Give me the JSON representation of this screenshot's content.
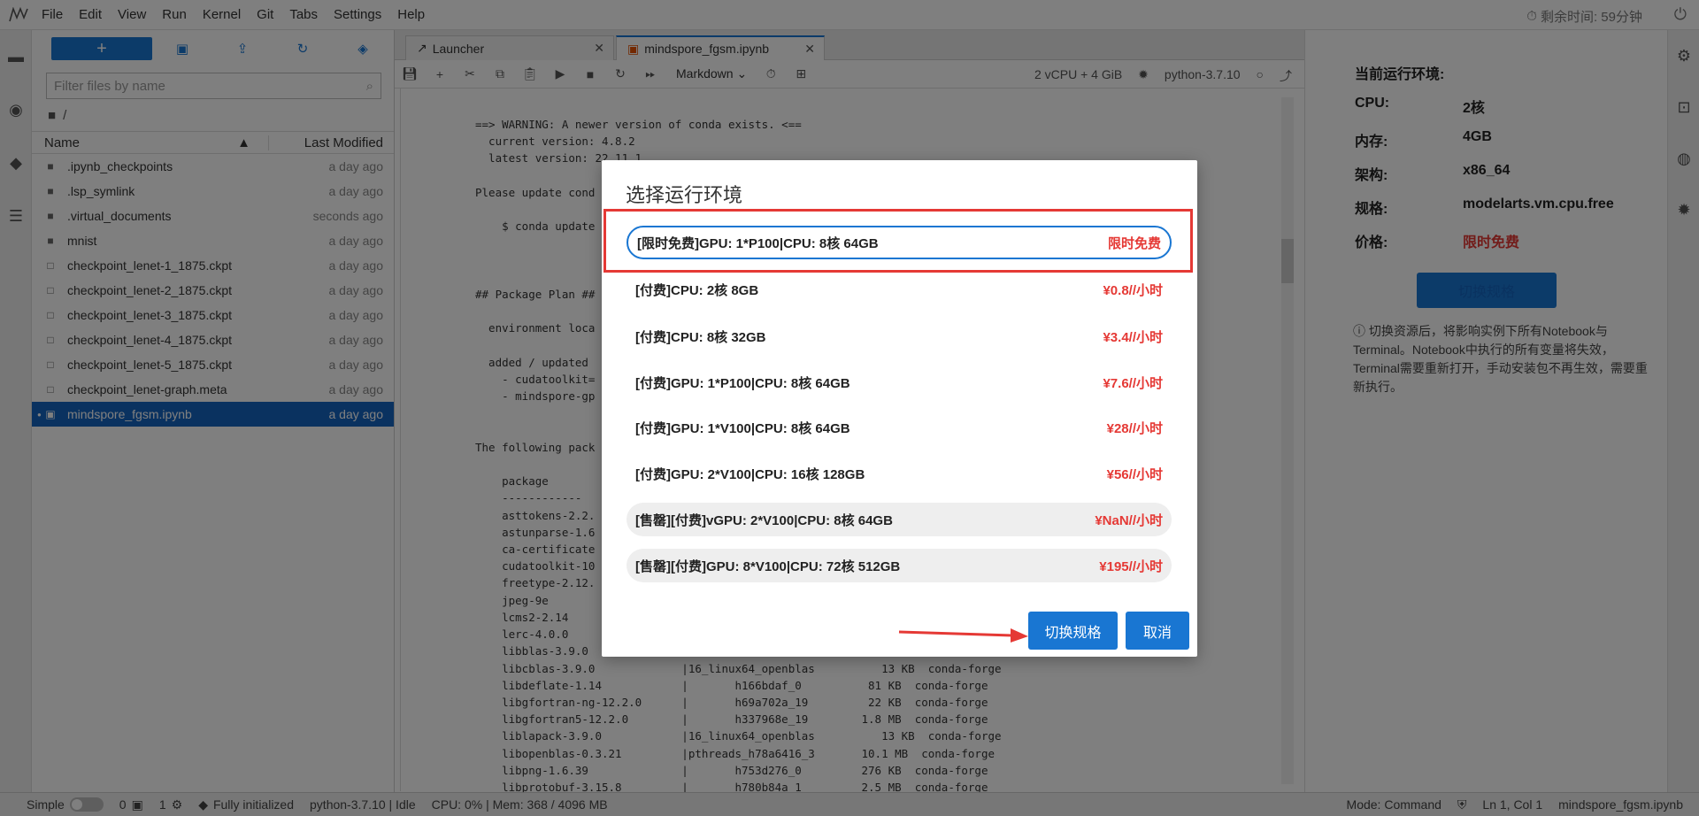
{
  "menubar": {
    "items": [
      "File",
      "Edit",
      "View",
      "Run",
      "Kernel",
      "Git",
      "Tabs",
      "Settings",
      "Help"
    ],
    "timer": "剩余时间: 59分钟"
  },
  "filebrowser": {
    "search_placeholder": "Filter files by name",
    "path": "/",
    "col_name": "Name",
    "col_modified": "Last Modified",
    "files": [
      {
        "name": ".ipynb_checkpoints",
        "modified": "a day ago",
        "type": "folder"
      },
      {
        "name": ".lsp_symlink",
        "modified": "a day ago",
        "type": "folder"
      },
      {
        "name": ".virtual_documents",
        "modified": "seconds ago",
        "type": "folder"
      },
      {
        "name": "mnist",
        "modified": "a day ago",
        "type": "folder"
      },
      {
        "name": "checkpoint_lenet-1_1875.ckpt",
        "modified": "a day ago",
        "type": "file"
      },
      {
        "name": "checkpoint_lenet-2_1875.ckpt",
        "modified": "a day ago",
        "type": "file"
      },
      {
        "name": "checkpoint_lenet-3_1875.ckpt",
        "modified": "a day ago",
        "type": "file"
      },
      {
        "name": "checkpoint_lenet-4_1875.ckpt",
        "modified": "a day ago",
        "type": "file"
      },
      {
        "name": "checkpoint_lenet-5_1875.ckpt",
        "modified": "a day ago",
        "type": "file"
      },
      {
        "name": "checkpoint_lenet-graph.meta",
        "modified": "a day ago",
        "type": "file"
      },
      {
        "name": "mindspore_fgsm.ipynb",
        "modified": "a day ago",
        "type": "notebook"
      }
    ]
  },
  "tabs": {
    "launcher": "Launcher",
    "notebook": "mindspore_fgsm.ipynb"
  },
  "toolbar": {
    "cell_type": "Markdown",
    "resources": "2 vCPU + 4 GiB",
    "kernel": "python-3.7.10"
  },
  "output_lines": [
    "==> WARNING: A newer version of conda exists. <==",
    "  current version: 4.8.2",
    "  latest version: 22.11.1",
    "",
    "Please update cond",
    "",
    "    $ conda update",
    "",
    "",
    "",
    "## Package Plan ##",
    "",
    "  environment loca",
    "",
    "  added / updated",
    "    - cudatoolkit=",
    "    - mindspore-gp",
    "",
    "",
    "The following pack",
    "",
    "    package",
    "    ------------",
    "    asttokens-2.2.",
    "    astunparse-1.6",
    "    ca-certificate",
    "    cudatoolkit-10",
    "    freetype-2.12.",
    "    jpeg-9e",
    "    lcms2-2.14",
    "    lerc-4.0.0",
    "    libblas-3.9.0",
    "    libcblas-3.9.0             |16_linux64_openblas          13 KB  conda-forge",
    "    libdeflate-1.14            |       h166bdaf_0          81 KB  conda-forge",
    "    libgfortran-ng-12.2.0      |       h69a702a_19         22 KB  conda-forge",
    "    libgfortran5-12.2.0        |       h337968e_19        1.8 MB  conda-forge",
    "    liblapack-3.9.0            |16_linux64_openblas          13 KB  conda-forge",
    "    libopenblas-0.3.21         |pthreads_h78a6416_3       10.1 MB  conda-forge",
    "    libpng-1.6.39              |       h753d276_0         276 KB  conda-forge",
    "    libprotobuf-3.15.8         |       h780b84a_1         2.5 MB  conda-forge"
  ],
  "rightpanel": {
    "title": "当前运行环境:",
    "rows": [
      {
        "k": "CPU:",
        "v": "2核"
      },
      {
        "k": "内存:",
        "v": "4GB"
      },
      {
        "k": "架构:",
        "v": "x86_64"
      },
      {
        "k": "规格:",
        "v": "modelarts.vm.cpu.free"
      },
      {
        "k": "价格:",
        "v": "限时免费"
      }
    ],
    "switch_label": "切换规格",
    "note": "ⓘ 切换资源后，将影响实例下所有Notebook与Terminal。Notebook中执行的所有变量将失效，Terminal需要重新打开，手动安装包不再生效，需要重新执行。"
  },
  "statusbar": {
    "simple": "Simple",
    "count1": "0",
    "count2": "1",
    "initialized": "Fully initialized",
    "kernel_status": "python-3.7.10 | Idle",
    "mem": "CPU: 0% | Mem: 368 / 4096 MB",
    "mode": "Mode: Command",
    "cursor": "Ln 1, Col 1",
    "file": "mindspore_fgsm.ipynb"
  },
  "modal": {
    "title": "选择运行环境",
    "options": [
      {
        "label": "[限时免费]GPU: 1*P100|CPU: 8核 64GB",
        "price": "限时免费",
        "state": "selected"
      },
      {
        "label": "[付费]CPU: 2核 8GB",
        "price": "¥0.8//小时",
        "state": "normal"
      },
      {
        "label": "[付费]CPU: 8核 32GB",
        "price": "¥3.4//小时",
        "state": "normal"
      },
      {
        "label": "[付费]GPU: 1*P100|CPU: 8核 64GB",
        "price": "¥7.6//小时",
        "state": "normal"
      },
      {
        "label": "[付费]GPU: 1*V100|CPU: 8核 64GB",
        "price": "¥28//小时",
        "state": "normal"
      },
      {
        "label": "[付费]GPU: 2*V100|CPU: 16核 128GB",
        "price": "¥56//小时",
        "state": "normal"
      },
      {
        "label": "[售罄][付费]vGPU: 2*V100|CPU: 8核 64GB",
        "price": "¥NaN//小时",
        "state": "soldout"
      },
      {
        "label": "[售罄][付费]GPU: 8*V100|CPU: 72核 512GB",
        "price": "¥195//小时",
        "state": "soldout"
      }
    ],
    "confirm": "切换规格",
    "cancel": "取消"
  },
  "colors": {
    "accent": "#1976d2",
    "price": "#e53935",
    "highlight": "#e53935"
  }
}
